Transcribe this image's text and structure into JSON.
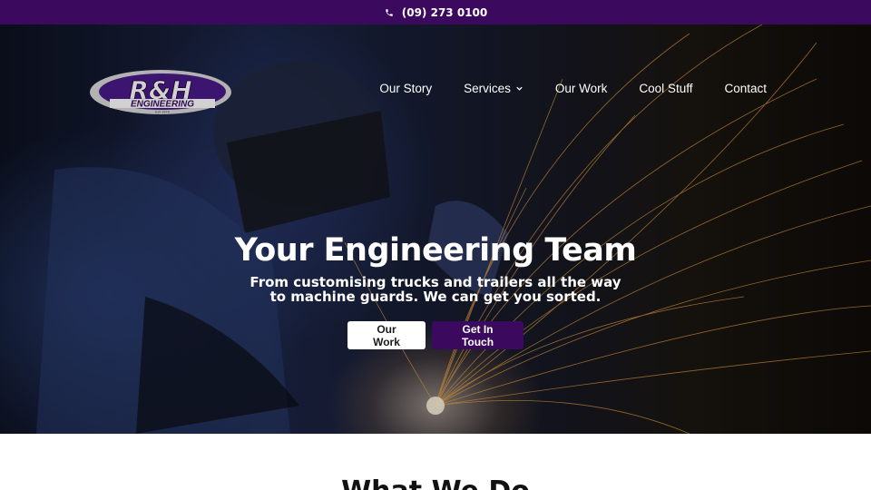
{
  "topbar": {
    "phone": "(09) 273 0100",
    "icon": "phone-icon"
  },
  "logo": {
    "brand": "R&H",
    "subtext": "ENGINEERING",
    "tagline": "Est 1979"
  },
  "nav": {
    "items": [
      {
        "label": "Our Story"
      },
      {
        "label": "Services",
        "icon": "chevron-down-icon"
      },
      {
        "label": "Our Work"
      },
      {
        "label": "Cool Stuff"
      },
      {
        "label": "Contact"
      }
    ]
  },
  "hero": {
    "title": "Your Engineering Team",
    "subtitle": "From customising trucks and trailers all the way to machine guards. We can get you sorted.",
    "buttons": {
      "primary": "Our Work",
      "secondary": "Get In Touch"
    }
  },
  "colors": {
    "brand_purple": "#3b0a5e",
    "white": "#ffffff"
  },
  "section": {
    "title": "What We Do"
  }
}
